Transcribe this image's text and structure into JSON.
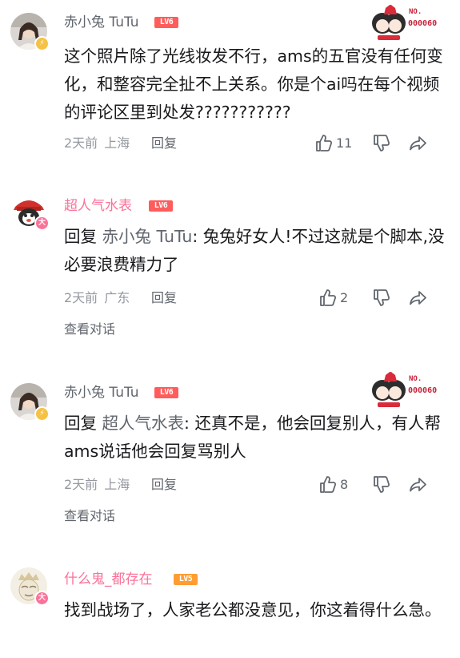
{
  "comments": [
    {
      "username": "赤小兔 TuTu",
      "level": "LV6",
      "fan_badge": {
        "label": "NO.",
        "number": "000060"
      },
      "text": "这个照片除了光线妆发不行，ams的五官没有任何变化，和整容完全扯不上关系。你是个ai吗在每个视频的评论区里到处发???????????",
      "time": "2天前",
      "location": "上海",
      "reply_label": "回复",
      "likes": "11"
    },
    {
      "username": "超人气水表",
      "level": "LV6",
      "reply_prefix": "回复",
      "reply_target": "赤小兔 TuTu",
      "text": ": 兔兔好女人!不过这就是个脚本,没必要浪费精力了",
      "time": "2天前",
      "location": "广东",
      "reply_label": "回复",
      "likes": "2",
      "view_conversation": "查看对话"
    },
    {
      "username": "赤小兔 TuTu",
      "level": "LV6",
      "fan_badge": {
        "label": "NO.",
        "number": "000060"
      },
      "reply_prefix": "回复",
      "reply_target": "超人气水表",
      "text": ": 还真不是，他会回复别人，有人帮ams说话他会回复骂别人",
      "time": "2天前",
      "location": "上海",
      "reply_label": "回复",
      "likes": "8",
      "view_conversation": "查看对话"
    },
    {
      "username": "什么鬼_都存在",
      "level": "LV5",
      "text": "找到战场了，人家老公都没意见，你这着得什么急。"
    }
  ],
  "icons": {
    "like": "thumbs-up-icon",
    "dislike": "thumbs-down-icon",
    "share": "share-icon"
  },
  "colors": {
    "vip_name": "#fb7299",
    "normal_name": "#61666d",
    "lv6": "#ff5c5c",
    "lv5": "#ff9d33",
    "meta": "#9499a0"
  }
}
